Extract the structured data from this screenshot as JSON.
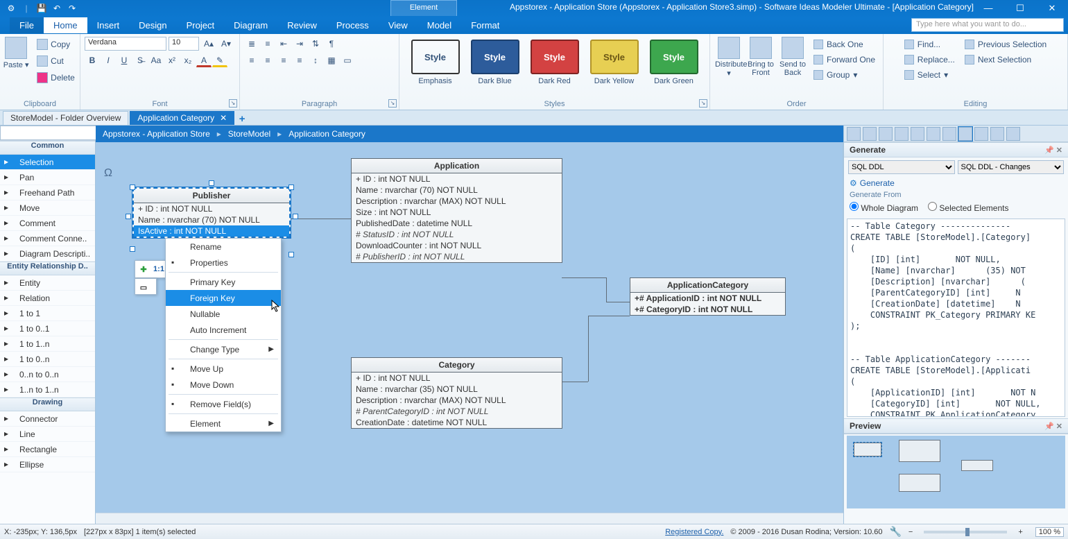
{
  "title": "Appstorex - Application Store (Appstorex - Application Store3.simp)  - Software Ideas Modeler Ultimate - [Application Category]",
  "element_tab": "Element",
  "menu": {
    "file": "File",
    "home": "Home",
    "insert": "Insert",
    "design": "Design",
    "project": "Project",
    "diagram": "Diagram",
    "review": "Review",
    "process": "Process",
    "view": "View",
    "model": "Model",
    "format": "Format"
  },
  "search_help_placeholder": "Type here what you want to do...",
  "ribbon": {
    "clipboard": {
      "paste": "Paste",
      "copy": "Copy",
      "cut": "Cut",
      "delete": "Delete",
      "label": "Clipboard"
    },
    "font": {
      "name": "Verdana",
      "size": "10",
      "label": "Font"
    },
    "paragraph": {
      "label": "Paragraph"
    },
    "styles": {
      "label": "Styles",
      "items": [
        {
          "name": "Style",
          "caption": "Emphasis",
          "cls": ""
        },
        {
          "name": "Style",
          "caption": "Dark Blue",
          "cls": "blue"
        },
        {
          "name": "Style",
          "caption": "Dark Red",
          "cls": "red"
        },
        {
          "name": "Style",
          "caption": "Dark Yellow",
          "cls": "yel"
        },
        {
          "name": "Style",
          "caption": "Dark Green",
          "cls": "grn"
        }
      ]
    },
    "order": {
      "distribute": "Distribute",
      "btf": "Bring to Front",
      "stb": "Send to Back",
      "backone": "Back One",
      "fwdone": "Forward One",
      "group": "Group",
      "label": "Order"
    },
    "editing": {
      "find": "Find...",
      "replace": "Replace...",
      "select": "Select",
      "prevsel": "Previous Selection",
      "nextsel": "Next Selection",
      "label": "Editing"
    }
  },
  "tabs": {
    "overview": "StoreModel - Folder Overview",
    "active": "Application Category"
  },
  "breadcrumb": [
    "Appstorex - Application Store",
    "StoreModel",
    "Application Category"
  ],
  "toolbox": {
    "cat1": "Common",
    "items1": [
      "Selection",
      "Pan",
      "Freehand Path",
      "Move",
      "Comment",
      "Comment Conne..",
      "Diagram Descripti.."
    ],
    "cat2": "Entity Relationship D..",
    "items2": [
      "Entity",
      "Relation",
      "1 to 1",
      "1 to 0..1",
      "1 to 1..n",
      "1 to 0..n",
      "0..n to 0..n",
      "1..n to 1..n"
    ],
    "cat3": "Drawing",
    "items3": [
      "Connector",
      "Line",
      "Rectangle",
      "Ellipse"
    ]
  },
  "float_toolbar": "1:1",
  "entities": {
    "publisher": {
      "title": "Publisher",
      "rows": [
        "+ ID : int NOT NULL",
        "Name : nvarchar (70)  NOT NULL",
        "IsActive : int NOT NULL"
      ]
    },
    "application": {
      "title": "Application",
      "rows": [
        "+ ID : int NOT NULL",
        "Name : nvarchar (70)  NOT NULL",
        "Description : nvarchar (MAX)  NOT NULL",
        "Size : int NOT NULL",
        "PublishedDate : datetime NULL",
        "# StatusID : int NOT NULL",
        "DownloadCounter : int NOT NULL",
        "# PublisherID : int NOT NULL"
      ]
    },
    "appcat": {
      "title": "ApplicationCategory",
      "rows": [
        "+# ApplicationID : int NOT NULL",
        "+# CategoryID : int NOT NULL"
      ]
    },
    "category": {
      "title": "Category",
      "rows": [
        "+ ID : int NOT NULL",
        "Name : nvarchar (35)  NOT NULL",
        "Description : nvarchar (MAX)  NOT NULL",
        "# ParentCategoryID : int NOT NULL",
        "CreationDate : datetime NOT NULL"
      ]
    }
  },
  "context_menu": {
    "items": [
      {
        "label": "Rename"
      },
      {
        "label": "Properties",
        "icon": true
      },
      {
        "sep": true
      },
      {
        "label": "Primary Key"
      },
      {
        "label": "Foreign Key",
        "highlight": true
      },
      {
        "label": "Nullable"
      },
      {
        "label": "Auto Increment"
      },
      {
        "sep": true
      },
      {
        "label": "Change Type",
        "arrow": true
      },
      {
        "sep": true
      },
      {
        "label": "Move Up",
        "icon": true
      },
      {
        "label": "Move Down",
        "icon": true
      },
      {
        "sep": true
      },
      {
        "label": "Remove Field(s)",
        "icon": true
      },
      {
        "sep": true
      },
      {
        "label": "Element",
        "arrow": true
      }
    ]
  },
  "generate": {
    "title": "Generate",
    "sel1": "SQL DDL",
    "sel2": "SQL DDL - Changes",
    "button": "Generate",
    "from_label": "Generate From",
    "radio1": "Whole Diagram",
    "radio2": "Selected Elements",
    "code": "-- Table Category --------------\nCREATE TABLE [StoreModel].[Category]\n(\n    [ID] [int]       NOT NULL,\n    [Name] [nvarchar]      (35) NOT\n    [Description] [nvarchar]      (\n    [ParentCategoryID] [int]     N\n    [CreationDate] [datetime]    N\n    CONSTRAINT PK_Category PRIMARY KE\n);\n\n\n-- Table ApplicationCategory -------\nCREATE TABLE [StoreModel].[Applicati\n(\n    [ApplicationID] [int]       NOT N\n    [CategoryID] [int]       NOT NULL,\n    CONSTRAINT PK ApplicationCategory"
  },
  "preview_title": "Preview",
  "status": {
    "pos": "X: -235px; Y: 136,5px",
    "sel": "[227px x 83px] 1 item(s) selected",
    "reg": "Registered Copy.",
    "copy": "© 2009 - 2016 Dusan Rodina; Version: 10.60",
    "zoom": "100 %"
  }
}
